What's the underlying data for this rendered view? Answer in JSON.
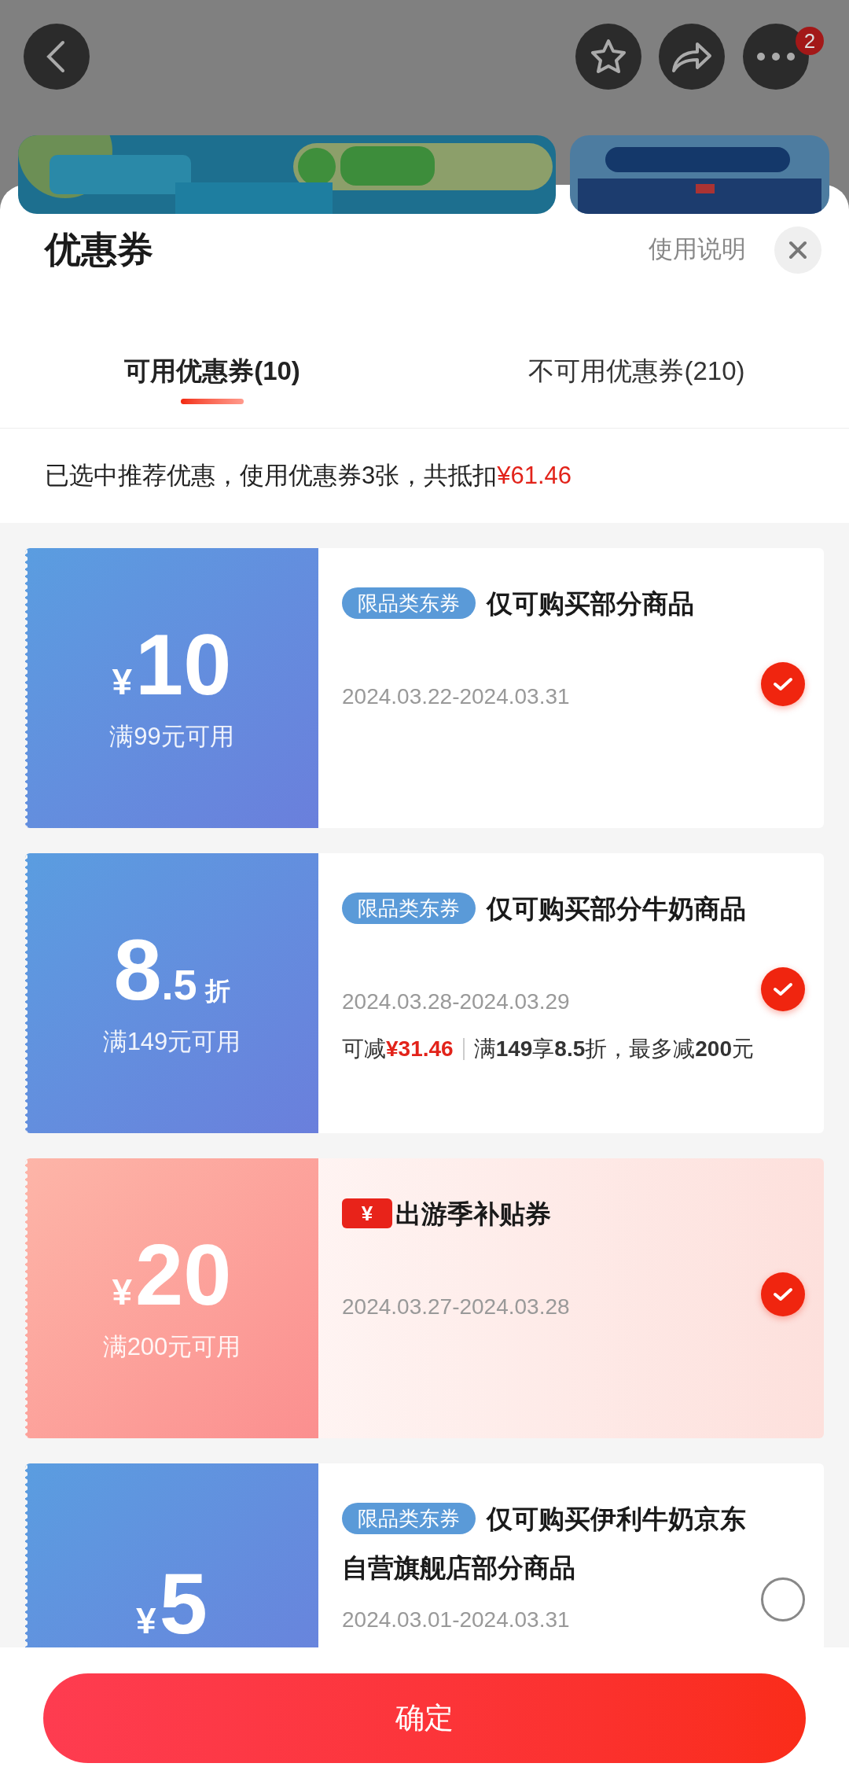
{
  "top_bar": {
    "menu_badge": "2"
  },
  "sheet": {
    "title": "优惠券",
    "help_link": "使用说明"
  },
  "tabs": [
    {
      "label": "可用优惠券(10)",
      "selected": true
    },
    {
      "label": "不可用优惠券(210)",
      "selected": false
    }
  ],
  "summary": {
    "text": "已选中推荐优惠，使用优惠券3张，共抵扣",
    "amount": "¥61.46"
  },
  "coupons": [
    {
      "kind": "jd",
      "prefix": "¥",
      "number": "10",
      "condition": "满99元可用",
      "tag": "限品类东券",
      "title_lines": [
        "仅可购买部分商品"
      ],
      "dates": "2024.03.22-2024.03.31",
      "selected": true
    },
    {
      "kind": "jd",
      "number": "8",
      "decimal": ".5",
      "unit": "折",
      "condition": "满149元可用",
      "tag": "限品类东券",
      "title_lines": [
        "仅可购买部分牛奶商品"
      ],
      "dates": "2024.03.28-2024.03.29",
      "saving_label": "可减",
      "saving_amount": "¥31.46",
      "rule": "满**149**享**8.5**折，最多减**200**元",
      "selected": true
    },
    {
      "kind": "travel",
      "prefix": "¥",
      "number": "20",
      "condition": "满200元可用",
      "tag": "¥",
      "title_lines": [
        "出游季补贴券"
      ],
      "dates": "2024.03.27-2024.03.28",
      "selected": true
    },
    {
      "kind": "jd",
      "prefix": "¥",
      "number": "5",
      "tag": "限品类东券",
      "title_lines": [
        "仅可购买伊利牛奶京东",
        "自营旗舰店部分商品"
      ],
      "dates": "2024.03.01-2024.03.31",
      "selected": false
    }
  ],
  "confirm_button": "确定"
}
